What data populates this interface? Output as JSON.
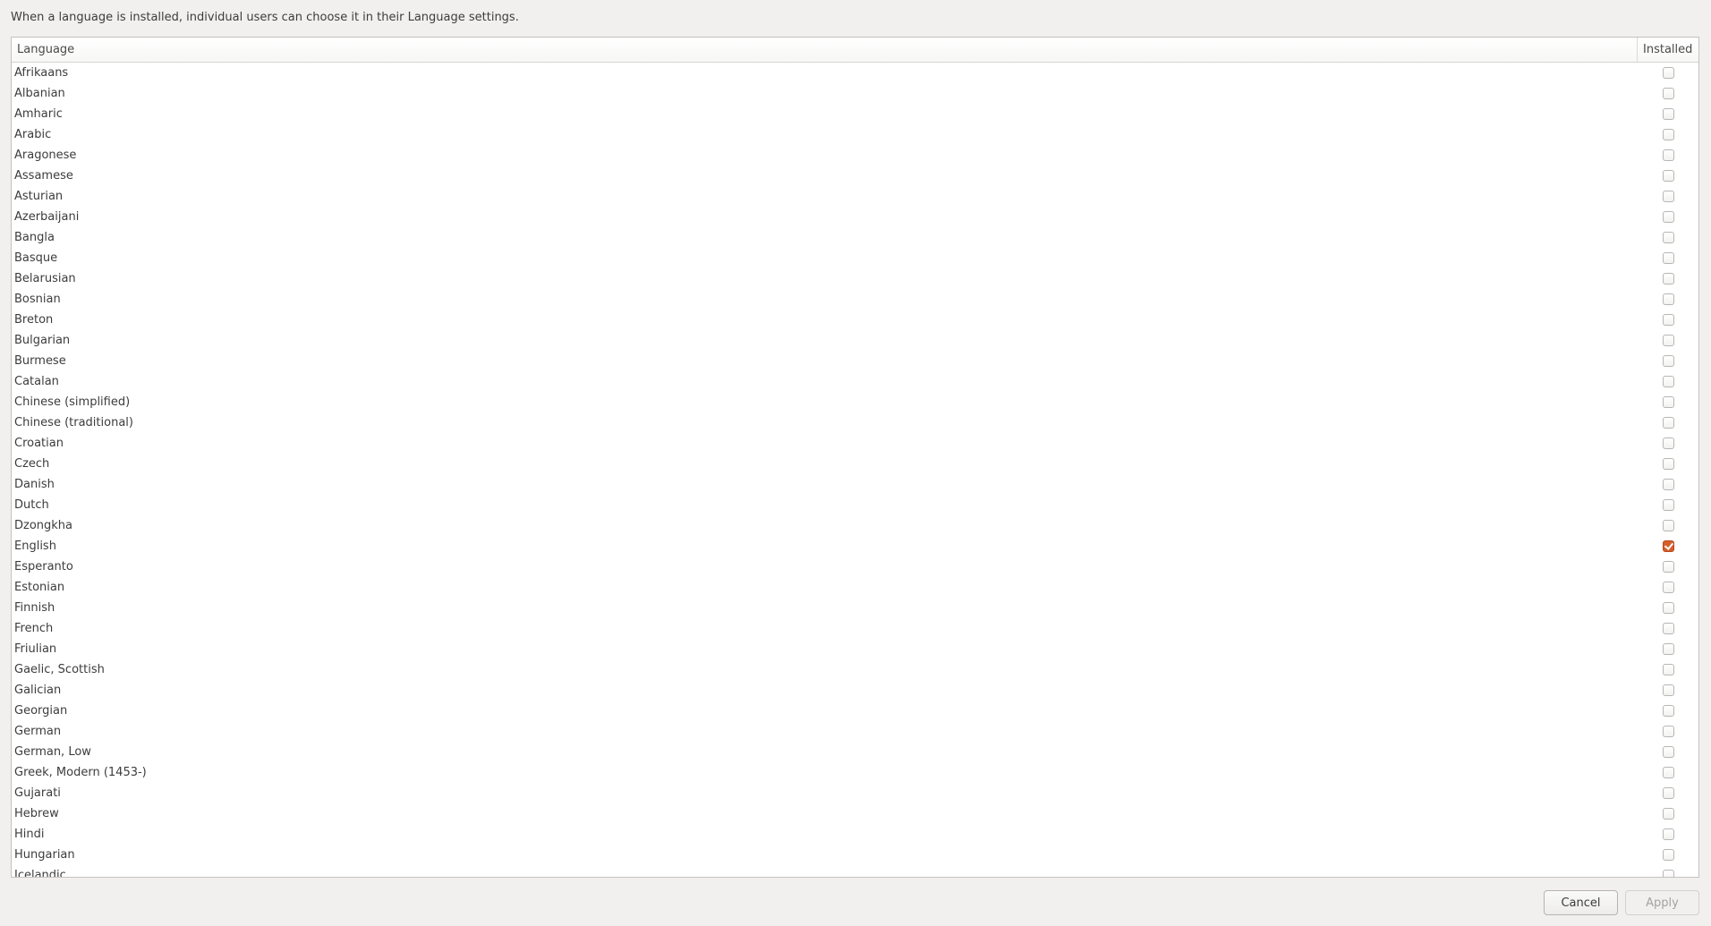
{
  "description": "When a language is installed, individual users can choose it in their Language settings.",
  "table": {
    "columns": {
      "language": "Language",
      "installed": "Installed"
    },
    "rows": [
      {
        "language": "Afrikaans",
        "installed": false
      },
      {
        "language": "Albanian",
        "installed": false
      },
      {
        "language": "Amharic",
        "installed": false
      },
      {
        "language": "Arabic",
        "installed": false
      },
      {
        "language": "Aragonese",
        "installed": false
      },
      {
        "language": "Assamese",
        "installed": false
      },
      {
        "language": "Asturian",
        "installed": false
      },
      {
        "language": "Azerbaijani",
        "installed": false
      },
      {
        "language": "Bangla",
        "installed": false
      },
      {
        "language": "Basque",
        "installed": false
      },
      {
        "language": "Belarusian",
        "installed": false
      },
      {
        "language": "Bosnian",
        "installed": false
      },
      {
        "language": "Breton",
        "installed": false
      },
      {
        "language": "Bulgarian",
        "installed": false
      },
      {
        "language": "Burmese",
        "installed": false
      },
      {
        "language": "Catalan",
        "installed": false
      },
      {
        "language": "Chinese (simplified)",
        "installed": false
      },
      {
        "language": "Chinese (traditional)",
        "installed": false
      },
      {
        "language": "Croatian",
        "installed": false
      },
      {
        "language": "Czech",
        "installed": false
      },
      {
        "language": "Danish",
        "installed": false
      },
      {
        "language": "Dutch",
        "installed": false
      },
      {
        "language": "Dzongkha",
        "installed": false
      },
      {
        "language": "English",
        "installed": true
      },
      {
        "language": "Esperanto",
        "installed": false
      },
      {
        "language": "Estonian",
        "installed": false
      },
      {
        "language": "Finnish",
        "installed": false
      },
      {
        "language": "French",
        "installed": false
      },
      {
        "language": "Friulian",
        "installed": false
      },
      {
        "language": "Gaelic, Scottish",
        "installed": false
      },
      {
        "language": "Galician",
        "installed": false
      },
      {
        "language": "Georgian",
        "installed": false
      },
      {
        "language": "German",
        "installed": false
      },
      {
        "language": "German, Low",
        "installed": false
      },
      {
        "language": "Greek, Modern (1453-)",
        "installed": false
      },
      {
        "language": "Gujarati",
        "installed": false
      },
      {
        "language": "Hebrew",
        "installed": false
      },
      {
        "language": "Hindi",
        "installed": false
      },
      {
        "language": "Hungarian",
        "installed": false
      },
      {
        "language": "Icelandic",
        "installed": false
      }
    ]
  },
  "buttons": {
    "cancel": "Cancel",
    "apply": "Apply"
  },
  "colors": {
    "accent": "#d35f2b"
  }
}
